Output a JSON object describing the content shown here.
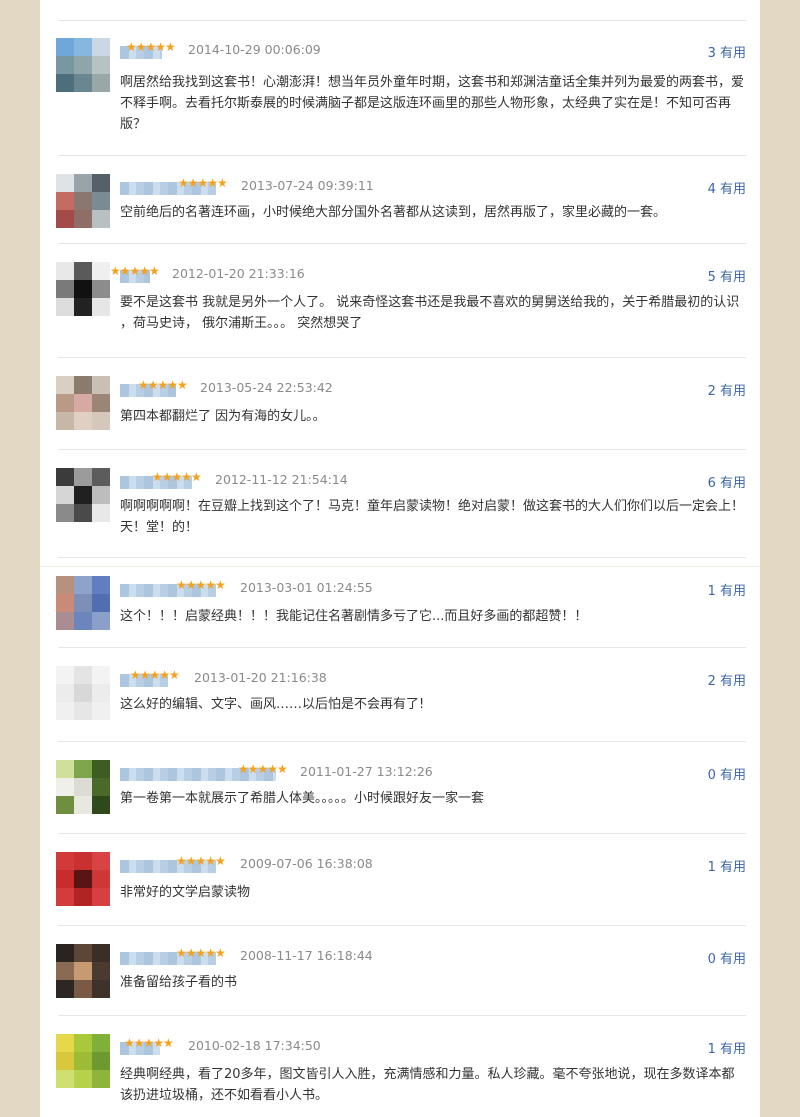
{
  "useful_suffix": "有用",
  "reviews": [
    {
      "stars": "★★★★★",
      "date": "2014-10-29 00:06:09",
      "count": "3",
      "content": "啊居然给我找到这套书！心潮澎湃！想当年员外童年时期，这套书和郑渊洁童话全集并列为最爱的两套书，爱不释手啊。去看托尔斯泰展的时候满脑子都是这版连环画里的那些人物形象，太经典了实在是！不知可否再版？",
      "avatar_colors": [
        "#6fa8d8",
        "#86b7df",
        "#c9d8e4",
        "#7897a3",
        "#8fa4ab",
        "#b7c2c4",
        "#4d6f7c",
        "#6a8690",
        "#9aa7a8"
      ]
    },
    {
      "stars": "★★★★★",
      "date": "2013-07-24 09:39:11",
      "count": "4",
      "content": "空前绝后的名著连环画，小时候绝大部分国外名著都从这读到，居然再版了，家里必藏的一套。",
      "avatar_colors": [
        "#e0e3e6",
        "#9aa3aa",
        "#56606a",
        "#c66b62",
        "#8c7670",
        "#7b8b93",
        "#a24b48",
        "#8f6e68",
        "#b8c0c4"
      ]
    },
    {
      "stars": "★★★★★",
      "date": "2012-01-20 21:33:16",
      "count": "5",
      "content": "要不是这套书 我就是另外一个人了。 说来奇怪这套书还是我最不喜欢的舅舅送给我的，关于希腊最初的认识 ，荷马史诗， 俄尔浦斯王。。。 突然想哭了",
      "avatar_colors": [
        "#e8e8e8",
        "#5a5a5a",
        "#efefef",
        "#7a7a7a",
        "#111111",
        "#8c8c8c",
        "#dddddd",
        "#222222",
        "#e6e6e6"
      ]
    },
    {
      "stars": "★★★★★",
      "date": "2013-05-24 22:53:42",
      "count": "2",
      "content": "第四本都翻烂了 因为有海的女儿。。",
      "avatar_colors": [
        "#d9cfc3",
        "#8a7b6c",
        "#c9bfb2",
        "#b99a86",
        "#d7a9a3",
        "#9a8577",
        "#c7b7a6",
        "#e2cfc4",
        "#d5c8ba"
      ]
    },
    {
      "stars": "★★★★★",
      "date": "2012-11-12 21:54:14",
      "count": "6",
      "content": "啊啊啊啊啊！在豆瓣上找到这个了！马克！童年启蒙读物！绝对启蒙！做这套书的大人们你们以后一定会上！天！堂！的！",
      "avatar_colors": [
        "#3b3b3b",
        "#9b9b9b",
        "#5c5c5c",
        "#d6d6d6",
        "#202020",
        "#bdbdbd",
        "#8a8a8a",
        "#4a4a4a",
        "#e8e8e8"
      ]
    },
    {
      "stars": "★★★★★",
      "date": "2013-03-01 01:24:55",
      "count": "1",
      "content": "这个！！！启蒙经典！！！我能记住名著剧情多亏了它...而且好多画的都超赞！！",
      "avatar_colors": [
        "#b8907e",
        "#8ea3c9",
        "#5f7fc0",
        "#c98b78",
        "#7d8fb6",
        "#4f6fb0",
        "#a98d92",
        "#6c86bd",
        "#8aa0c8"
      ]
    },
    {
      "stars": "★★★★★",
      "date": "2013-01-20 21:16:38",
      "count": "2",
      "content": "这么好的编辑、文字、画风……以后怕是不会再有了!",
      "avatar_colors": [
        "#f3f3f3",
        "#e4e4e4",
        "#f3f3f3",
        "#ececec",
        "#d8d8d8",
        "#ececec",
        "#f0f0f0",
        "#e6e6e6",
        "#f0f0f0"
      ]
    },
    {
      "stars": "★★★★★",
      "date": "2011-01-27 13:12:26",
      "count": "0",
      "content": "第一卷第一本就展示了希腊人体美。。。。。小时候跟好友一家一套",
      "avatar_colors": [
        "#cfe09a",
        "#7ea64a",
        "#3c5e22",
        "#f0f0ea",
        "#dcdcd4",
        "#4a6a2a",
        "#6e8f3f",
        "#e8e8e0",
        "#2f4a1a"
      ]
    },
    {
      "stars": "★★★★★",
      "date": "2009-07-06 16:38:08",
      "count": "1",
      "content": "非常好的文学启蒙读物",
      "avatar_colors": [
        "#d23a3a",
        "#c93030",
        "#d84444",
        "#c82c2c",
        "#5a1414",
        "#cf3636",
        "#d43c3c",
        "#b22424",
        "#d64040"
      ]
    },
    {
      "stars": "★★★★★",
      "date": "2008-11-17 16:18:44",
      "count": "0",
      "content": "准备留给孩子看的书",
      "avatar_colors": [
        "#2a2420",
        "#5b4638",
        "#3a2e26",
        "#8a6a52",
        "#c89a72",
        "#4a3a30",
        "#2e2622",
        "#7a5a44",
        "#3e322a"
      ]
    },
    {
      "stars": "★★★★★",
      "date": "2010-02-18 17:34:50",
      "count": "1",
      "content": "经典啊经典，看了20多年，图文皆引人入胜，充满情感和力量。私人珍藏。毫不夸张地说，现在多数译本都该扔进垃圾桶，还不如看看小人书。",
      "avatar_colors": [
        "#e6d84a",
        "#a9c93a",
        "#7fb03a",
        "#d9c83e",
        "#9cbc36",
        "#6c9a30",
        "#cfe070",
        "#b6d24a",
        "#8fb43c"
      ]
    }
  ]
}
